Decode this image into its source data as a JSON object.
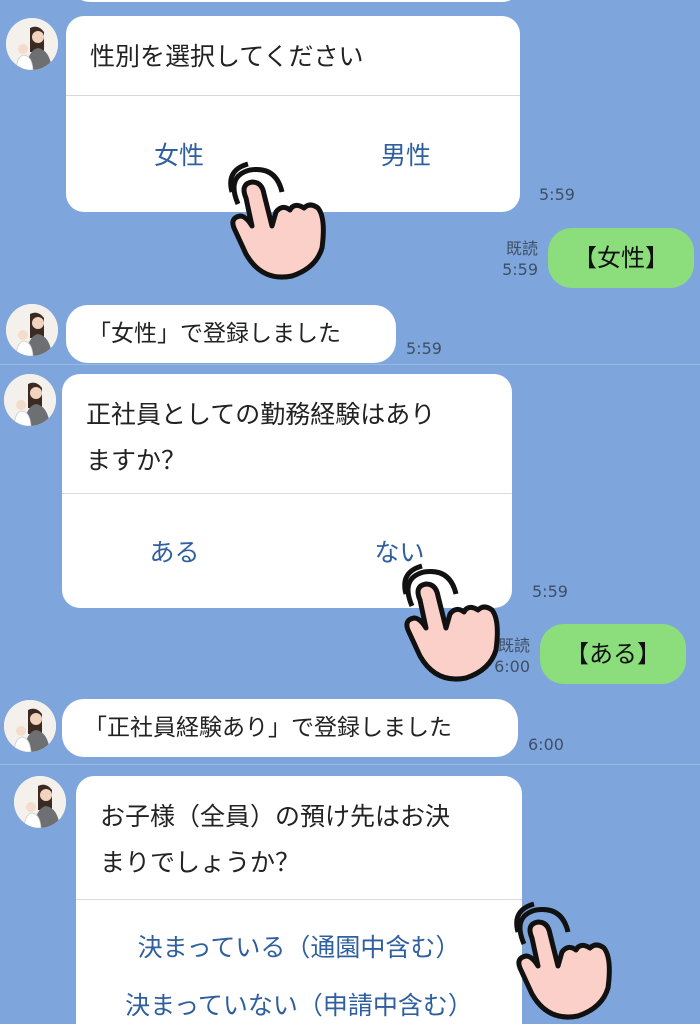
{
  "colors": {
    "background": "#7fa6dc",
    "card": "#ffffff",
    "option_text": "#2f5f9e",
    "user_bubble": "#8cde7c"
  },
  "messages": {
    "gender": {
      "question": "性別を選択してください",
      "option_female": "女性",
      "option_male": "男性",
      "time": "5:59"
    },
    "reply_gender": {
      "read": "既読",
      "time": "5:59",
      "text": "【女性】"
    },
    "confirm_gender": {
      "text": "「女性」で登録しました",
      "time": "5:59"
    },
    "experience": {
      "question_line1": "正社員としての勤務経験はあり",
      "question_line2": "ますか？",
      "option_yes": "ある",
      "option_no": "ない",
      "time": "5:59"
    },
    "reply_experience": {
      "read": "既読",
      "time": "6:00",
      "text": "【ある】"
    },
    "confirm_experience": {
      "text": "「正社員経験あり」で登録しました",
      "time": "6:00"
    },
    "childcare": {
      "question_line1": "お子様（全員）の預け先はお決",
      "question_line2": "まりでしょうか？",
      "option_decided": "決まっている（通園中含む）",
      "option_undecided": "決まっていない（申請中含む）"
    }
  },
  "icons": {
    "avatar": "avatar-mother-with-baby",
    "pointer": "pointing-hand-icon"
  }
}
